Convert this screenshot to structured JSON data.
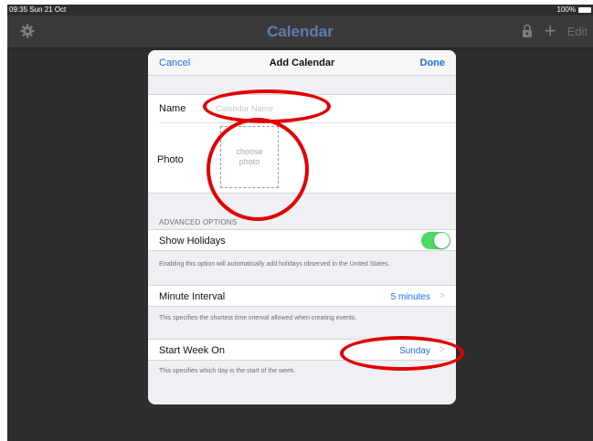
{
  "status_bar": {
    "time": "09:35  Sun 21 Oct",
    "battery": "100%"
  },
  "nav_bar": {
    "title": "Calendar",
    "settings_icon": "gear-icon",
    "lock_icon": "lock-icon",
    "add_icon": "plus-icon",
    "edit_label": "Edit"
  },
  "modal": {
    "cancel_label": "Cancel",
    "title": "Add Calendar",
    "done_label": "Done",
    "name": {
      "label": "Name",
      "placeholder": "Calendar Name",
      "value": ""
    },
    "photo": {
      "label": "Photo",
      "choose_label": "choose photo"
    },
    "advanced": {
      "section_header": "ADVANCED OPTIONS",
      "show_holidays": {
        "label": "Show Holidays",
        "enabled": true,
        "footnote": "Enabling this option will automatically add holidays observed in the United States."
      },
      "minute_interval": {
        "label": "Minute Interval",
        "value": "5 minutes",
        "footnote": "This specifies the shortest time interval allowed when creating events."
      },
      "start_week_on": {
        "label": "Start Week On",
        "value": "Sunday",
        "footnote": "This specifies which day is the start of the week."
      }
    }
  },
  "colors": {
    "accent_blue": "#1f6fe2",
    "toggle_green": "#4cd964",
    "annotation_red": "#e10000",
    "nav_title": "#5e7fae"
  }
}
